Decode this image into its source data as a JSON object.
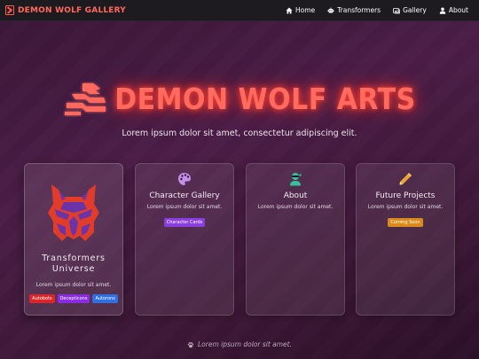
{
  "nav": {
    "brand": "Demon Wolf Gallery",
    "links": [
      {
        "label": "Home",
        "icon": "home-icon"
      },
      {
        "label": "Transformers",
        "icon": "robot-icon"
      },
      {
        "label": "Gallery",
        "icon": "images-icon"
      },
      {
        "label": "About",
        "icon": "user-icon"
      }
    ]
  },
  "hero": {
    "title": "Demon Wolf Arts",
    "subtitle": "Lorem ipsum dolor sit amet, consectetur adipiscing elit.",
    "accent": "#ff6b5e"
  },
  "cards": [
    {
      "title": "Transformers Universe",
      "text": "Lorem ipsum dolor sit amet.",
      "icon": "transformers-autobot-logo",
      "badges": [
        {
          "label": "Autobots",
          "color": "#d9262b"
        },
        {
          "label": "Decepticons",
          "color": "#8a2be2"
        },
        {
          "label": "Autorons",
          "color": "#2f6fe0"
        }
      ]
    },
    {
      "title": "Character Gallery",
      "text": "Lorem ipsum dolor sit amet.",
      "icon": "palette-icon",
      "badges": [
        {
          "label": "Character Cards",
          "color": "#8b3ee0"
        }
      ]
    },
    {
      "title": "About",
      "text": "Lorem ipsum dolor sit amet.",
      "icon": "user-ninja-icon",
      "badges": []
    },
    {
      "title": "Future Projects",
      "text": "Lorem ipsum dolor sit amet.",
      "icon": "pencil-icon",
      "badges": [
        {
          "label": "Coming Soon",
          "color": "#d98a1a"
        }
      ]
    }
  ],
  "footer": {
    "text": "Lorem ipsum dolor sit amet.",
    "icon": "paw-icon"
  }
}
